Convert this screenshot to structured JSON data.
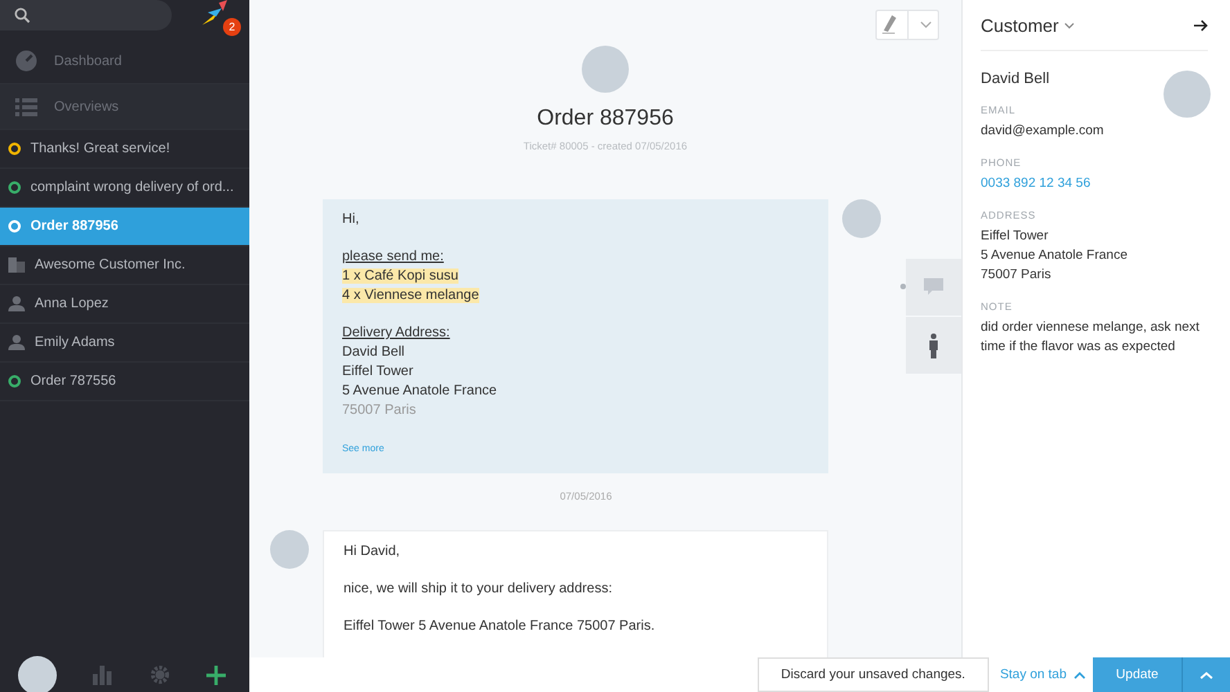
{
  "sidebar": {
    "notification_badge": "2",
    "nav": [
      {
        "label": "Dashboard",
        "kind": "dashboard"
      },
      {
        "label": "Overviews",
        "kind": "overviews"
      }
    ],
    "items": [
      {
        "label": "Thanks! Great service!",
        "kind": "ticket",
        "color": "#f0b400",
        "selected": false
      },
      {
        "label": "complaint wrong delivery of ord...",
        "kind": "ticket",
        "color": "#38ad69",
        "selected": false
      },
      {
        "label": "Order 887956",
        "kind": "ticket",
        "color": "#ffffff",
        "selected": true
      },
      {
        "label": "Awesome Customer Inc.",
        "kind": "organization",
        "selected": false
      },
      {
        "label": "Anna Lopez",
        "kind": "person",
        "selected": false
      },
      {
        "label": "Emily Adams",
        "kind": "person",
        "selected": false
      },
      {
        "label": "Order 787556",
        "kind": "ticket",
        "color": "#38ad69",
        "selected": false
      }
    ]
  },
  "ticket": {
    "title": "Order 887956",
    "meta": "Ticket# 80005 - created 07/05/2016",
    "articles": [
      {
        "kind": "customer",
        "paragraphs": [
          [
            {
              "text": "Hi,",
              "kind": "plain"
            }
          ],
          [
            {
              "text": "please send me:",
              "kind": "heading"
            },
            {
              "text": "1 x Café Kopi susu",
              "kind": "highlight"
            },
            {
              "text": "4 x Viennese melange",
              "kind": "highlight"
            }
          ],
          [
            {
              "text": "Delivery Address:",
              "kind": "heading"
            },
            {
              "text": "David Bell",
              "kind": "plain"
            },
            {
              "text": "Eiffel Tower",
              "kind": "plain"
            },
            {
              "text": "5 Avenue Anatole France",
              "kind": "plain"
            },
            {
              "text": "75007 Paris",
              "kind": "faded"
            }
          ]
        ],
        "see_more": "See more"
      },
      {
        "kind": "agent",
        "date": "07/05/2016",
        "paragraphs": [
          [
            {
              "text": "Hi David,",
              "kind": "plain"
            }
          ],
          [
            {
              "text": "nice, we will ship it to your delivery address:",
              "kind": "plain"
            }
          ],
          [
            {
              "text": "Eiffel Tower 5 Avenue Anatole France 75007 Paris.",
              "kind": "plain"
            }
          ]
        ]
      }
    ]
  },
  "customer_panel": {
    "title": "Customer",
    "name": "David Bell",
    "fields": [
      {
        "label": "EMAIL",
        "value": "david@example.com",
        "kind": "text"
      },
      {
        "label": "PHONE",
        "value": "0033 892 12 34 56",
        "kind": "link"
      },
      {
        "label": "ADDRESS",
        "value": "Eiffel Tower\n5 Avenue Anatole France\n75007 Paris",
        "kind": "text"
      },
      {
        "label": "NOTE",
        "value": "did order viennese melange, ask next time if the flavor was as expected",
        "kind": "text"
      }
    ]
  },
  "bottom_bar": {
    "discard": "Discard your unsaved changes.",
    "stay": "Stay on tab",
    "update": "Update"
  }
}
